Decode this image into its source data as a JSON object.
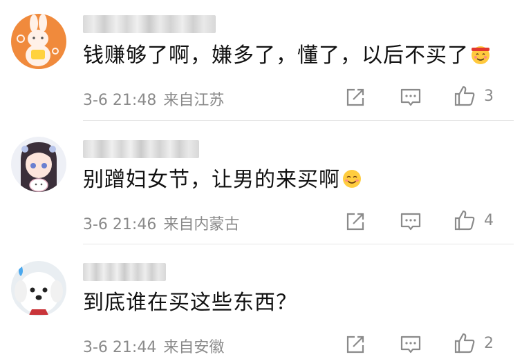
{
  "comments": [
    {
      "text": "钱赚够了啊，嫌多了，懂了，以后不买了",
      "emoji": "heart-faced-emoji-with-headband",
      "time": "3-6 21:48",
      "location": "来自江苏",
      "likes": "3",
      "avatar": "bunny-avatar"
    },
    {
      "text": "别蹭妇女节，让男的来买啊",
      "emoji": "smiling-face-emoji",
      "time": "3-6 21:46",
      "location": "来自内蒙古",
      "likes": "4",
      "avatar": "anime-girl-avatar"
    },
    {
      "text": "到底谁在买这些东西？",
      "emoji": "",
      "time": "3-6 21:44",
      "location": "来自安徽",
      "likes": "2",
      "avatar": "white-dog-avatar"
    }
  ],
  "colors": {
    "meta": "#8a8a8a",
    "text": "#111111",
    "divider": "#e6e6e6"
  }
}
